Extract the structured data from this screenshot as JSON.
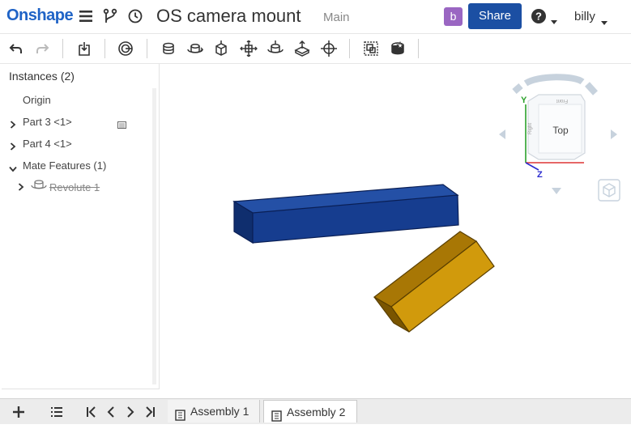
{
  "app": {
    "logo": "Onshape",
    "document_title": "OS camera mount",
    "workspace": "Main",
    "avatar_letter": "b",
    "share_label": "Share",
    "user_name": "billy",
    "brand_color": "#1f63c6",
    "share_color": "#1b4fa3",
    "avatar_color": "#9a66c2"
  },
  "toolbar": {
    "items": [
      "undo-icon",
      "redo-icon",
      "insert-icon",
      "mate-connector-icon",
      "fastened-mate-icon",
      "revolute-mate-icon",
      "slider-mate-icon",
      "planar-mate-icon",
      "cylindrical-mate-icon",
      "pin-slot-mate-icon",
      "ball-mate-icon",
      "group-icon",
      "replicate-icon"
    ]
  },
  "instances": {
    "title": "Instances (2)",
    "items": [
      {
        "label": "Origin"
      },
      {
        "label": "Part 3 <1>"
      },
      {
        "label": "Part 4 <1>"
      },
      {
        "label": "Mate Features (1)"
      },
      {
        "label": "Revolute 1",
        "suppressed": true
      }
    ]
  },
  "viewcube": {
    "face_label": "Top",
    "axis_y": "Y",
    "axis_z": "Z",
    "face_front": "Front",
    "face_right": "Right"
  },
  "parts": {
    "part3_color": "#163d8f",
    "part4_color": "#d19a0c"
  },
  "tabs": [
    {
      "label": "Assembly 1",
      "active": false
    },
    {
      "label": "Assembly 2",
      "active": true
    }
  ]
}
